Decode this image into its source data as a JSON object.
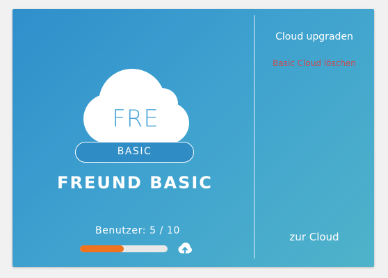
{
  "card": {
    "cloud_initials": "FRE",
    "plan_label": "BASIC",
    "cloud_name": "FREUND BASIC",
    "users_text": "Benutzer: 5 / 10",
    "users_used": 5,
    "users_max": 10,
    "upload_icon": "cloud-upload-icon"
  },
  "actions": {
    "upgrade_label": "Cloud upgraden",
    "delete_label": "Basic Cloud löschen",
    "goto_label": "zur Cloud"
  },
  "colors": {
    "gradient_start": "#2f8fcb",
    "gradient_end": "#4fb3ca",
    "progress_fill": "#f0731f",
    "progress_track": "#e8e8e8",
    "delete_link": "#c84a4e"
  }
}
